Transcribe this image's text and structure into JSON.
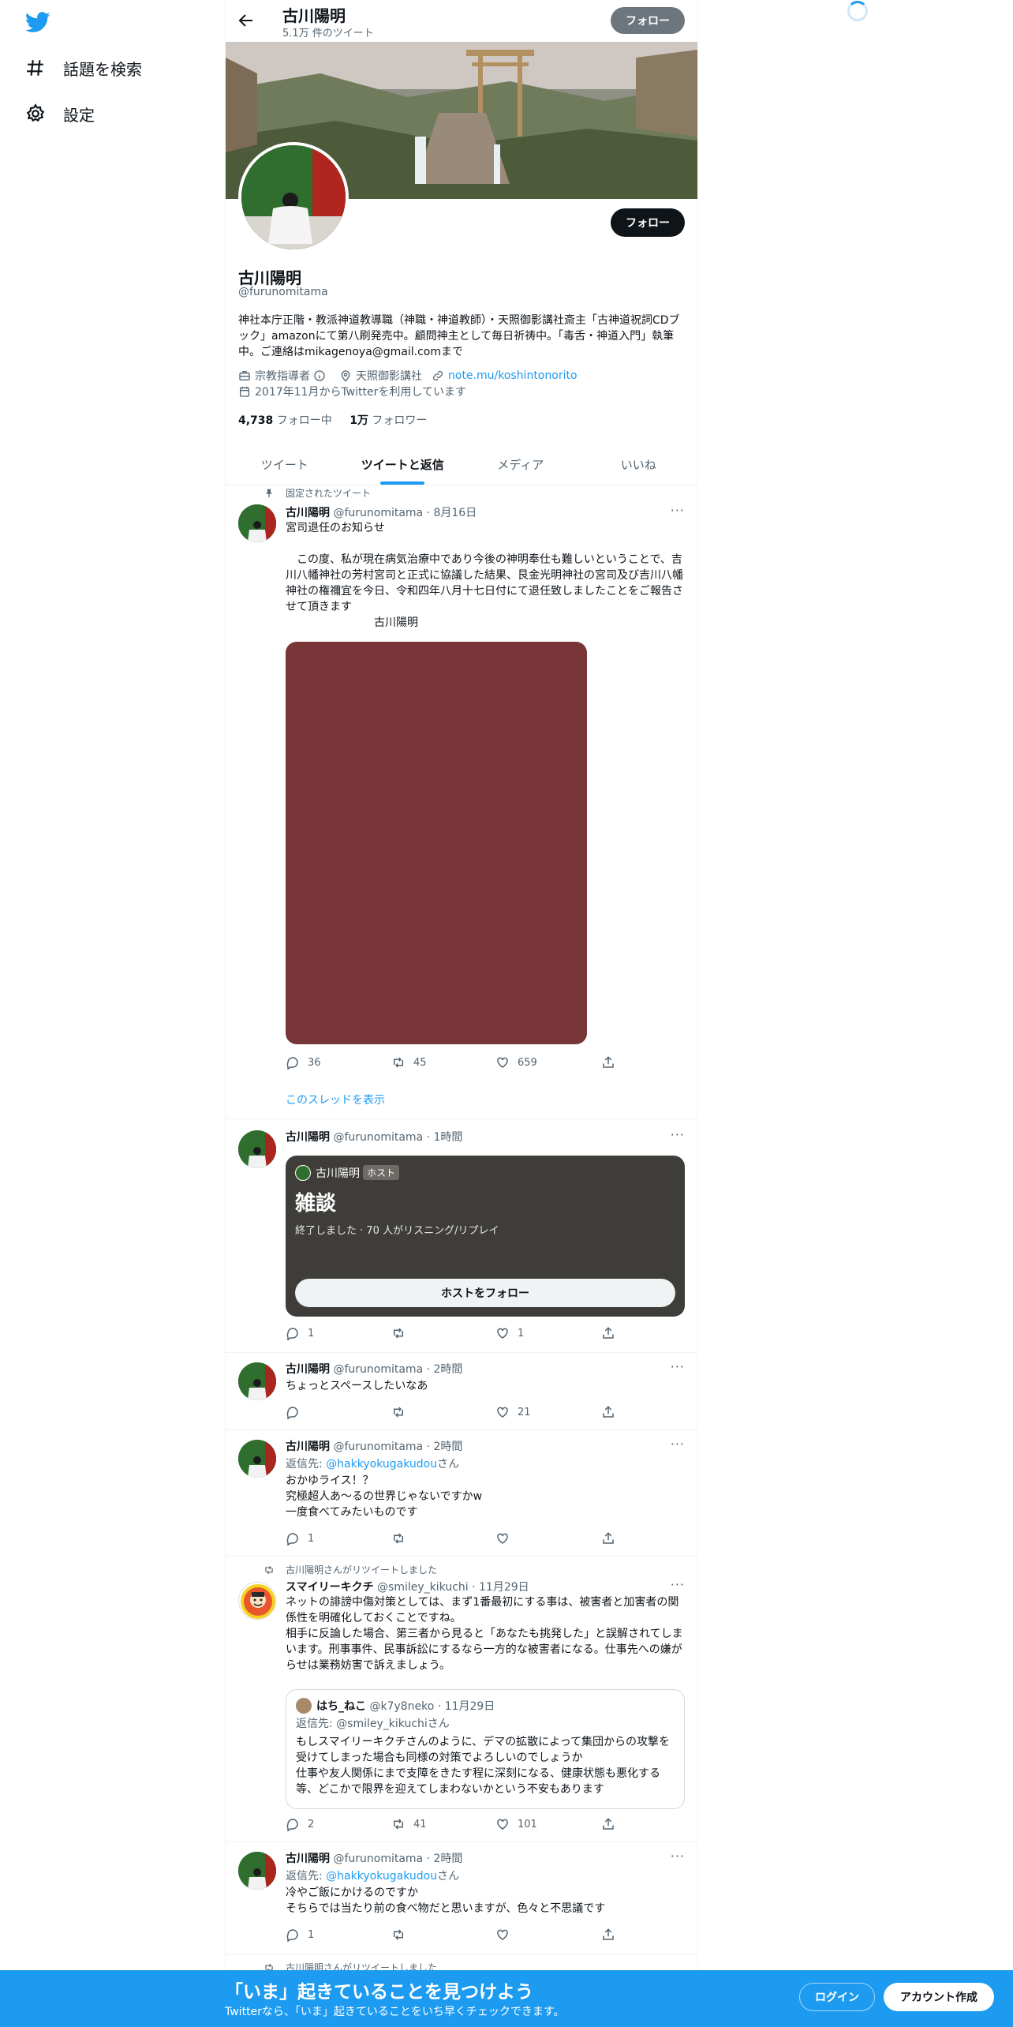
{
  "nav": {
    "explore_label": "話題を検索",
    "settings_label": "設定"
  },
  "topbar": {
    "name": "古川陽明",
    "tweet_count": "5.1万 件のツイート",
    "follow_label": "フォロー"
  },
  "profile": {
    "name": "古川陽明",
    "handle": "@furunomitama",
    "follow_label": "フォロー",
    "bio": "神社本庁正階・教派神道教導職（神職・神道教師）・天照御影講社斎主「古神道祝詞CDブック」amazonにて第八刷発売中。顧問神主として毎日祈祷中。「毒舌・神道入門」執筆中。ご連絡はmikagenoya@gmail.comまで",
    "category": "宗教指導者",
    "location": "天照御影講社",
    "website": "note.mu/koshintonorito",
    "joined": "2017年11月からTwitterを利用しています",
    "following_count": "4,738",
    "following_label": "フォロー中",
    "followers_count": "1万",
    "followers_label": "フォロワー"
  },
  "tabs": [
    {
      "label": "ツイート"
    },
    {
      "label": "ツイートと返信"
    },
    {
      "label": "メディア"
    },
    {
      "label": "いいね"
    }
  ],
  "tweets": {
    "pinned": {
      "pinned_label": "固定されたツイート",
      "name": "古川陽明",
      "meta": "@furunomitama · 8月16日",
      "text": "宮司退任のお知らせ\n\n　この度、私が現在病気治療中であり今後の神明奉仕も難しいということで、吉川八幡神社の芳村宮司と正式に協議した結果、艮金光明神社の宮司及び吉川八幡神社の権禰宜を今日、令和四年八月十七日付にて退任致しましたことをご報告させて頂きます\n　　　　　　　　古川陽明",
      "media_color": "#773537",
      "replies": "36",
      "retweets": "45",
      "likes": "659",
      "thread_label": "このスレッドを表示"
    },
    "space": {
      "name": "古川陽明",
      "meta": "@furunomitama · 1時間",
      "host_name": "古川陽明",
      "host_badge": "ホスト",
      "title": "雑談",
      "status": "終了しました · 70 人がリスニング/リプレイ",
      "follow_host_label": "ホストをフォロー",
      "replies": "1",
      "retweets": "",
      "likes": "1"
    },
    "t3": {
      "name": "古川陽明",
      "meta": "@furunomitama · 2時間",
      "text": "ちょっとスペースしたいなあ",
      "replies": "",
      "retweets": "",
      "likes": "21"
    },
    "t4": {
      "name": "古川陽明",
      "meta": "@furunomitama · 2時間",
      "reply_prefix": "返信先: ",
      "reply_handle": "@hakkyokugakudou",
      "reply_suffix": "さん",
      "text": "おかゆライス！？\n究極超人あ〜るの世界じゃないですかw\n一度食べてみたいものです",
      "replies": "1",
      "retweets": "",
      "likes": ""
    },
    "t5": {
      "retweet_label": "古川陽明さんがリツイートしました",
      "name": "スマイリーキクチ",
      "meta": "@smiley_kikuchi · 11月29日",
      "text": "ネットの誹謗中傷対策としては、まず1番最初にする事は、被害者と加害者の関係性を明確化しておくことですね。\n相手に反論した場合、第三者から見ると「あなたも挑発した」と誤解されてしまいます。刑事事件、民事訴訟にするなら一方的な被害者になる。仕事先への嫌がらせは業務妨害で訴えましょう。",
      "quote": {
        "name": "はち_ねこ",
        "meta": "@k7y8neko · 11月29日",
        "reply_line": "返信先: @smiley_kikuchiさん",
        "text": "もしスマイリーキクチさんのように、デマの拡散によって集団からの攻撃を受けてしまった場合も同様の対策でよろしいのでしょうか\n仕事や友人関係にまで支障をきたす程に深刻になる、健康状態も悪化する等、どこかで限界を迎えてしまわないかという不安もあります"
      },
      "replies": "2",
      "retweets": "41",
      "likes": "101"
    },
    "t6": {
      "name": "古川陽明",
      "meta": "@furunomitama · 2時間",
      "reply_prefix": "返信先: ",
      "reply_handle": "@hakkyokugakudou",
      "reply_suffix": "さん",
      "text": "冷やご飯にかけるのですか\nそちらでは当たり前の食べ物だと思いますが、色々と不思議です",
      "replies": "1",
      "retweets": "",
      "likes": ""
    },
    "t7": {
      "retweet_label": "古川陽明さんがリツイートしました"
    }
  },
  "footer": {
    "title": "「いま」起きていることを見つけよう",
    "subtitle": "Twitterなら、「いま」起きていることをいち早くチェックできます。",
    "login_label": "ログイン",
    "signup_label": "アカウント作成"
  },
  "colors": {
    "accent": "#1d9bf0",
    "footer_bg": "#1d9bf0",
    "space_card": "#3f3d3a"
  }
}
